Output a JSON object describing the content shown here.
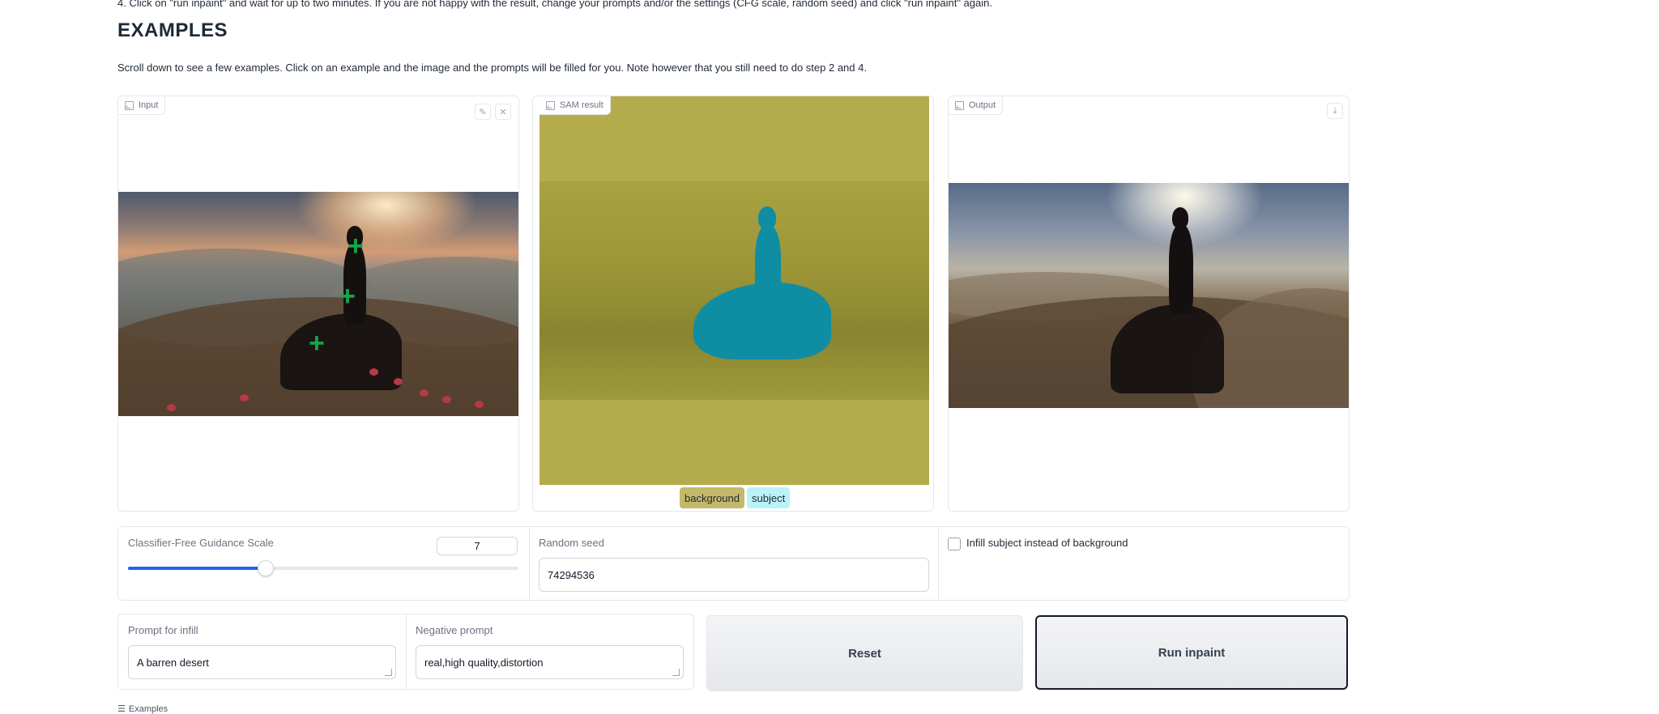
{
  "instructions": {
    "step4": "4. Click on \"run inpaint\" and wait for up to two minutes. If you are not happy with the result, change your prompts and/or the settings (CFG scale, random seed) and click \"run inpaint\" again."
  },
  "examples_section": {
    "heading": "EXAMPLES",
    "description": "Scroll down to see a few examples. Click on an example and the image and the prompts will be filled for you. Note however that you still need to do step 2 and 4."
  },
  "input_panel": {
    "label": "Input",
    "icons": {
      "edit": "pencil-icon",
      "clear": "close-icon"
    }
  },
  "sam_panel": {
    "label": "SAM result",
    "legend": [
      {
        "label": "background",
        "color": "#c4b96a"
      },
      {
        "label": "subject",
        "color": "#b9f3f8"
      }
    ]
  },
  "output_panel": {
    "label": "Output",
    "icons": {
      "download": "download-icon"
    }
  },
  "settings": {
    "cfg_label": "Classifier-Free Guidance Scale",
    "cfg_value": "7",
    "cfg_fraction": 0.35,
    "seed_label": "Random seed",
    "seed_value": "74294536",
    "infill_subject_label": "Infill subject instead of background",
    "infill_subject_checked": false
  },
  "prompts": {
    "infill_label": "Prompt for infill",
    "infill_value": "A barren desert",
    "negative_label": "Negative prompt",
    "negative_value": "real,high quality,distortion"
  },
  "buttons": {
    "reset": "Reset",
    "run": "Run inpaint"
  },
  "examples_footer": {
    "label": "Examples",
    "icon": "list-icon"
  },
  "colors": {
    "accent": "#2563eb",
    "segment_background": "#b4ac4c",
    "segment_subject": "#0f8da3",
    "point_marker": "#16a34a"
  }
}
